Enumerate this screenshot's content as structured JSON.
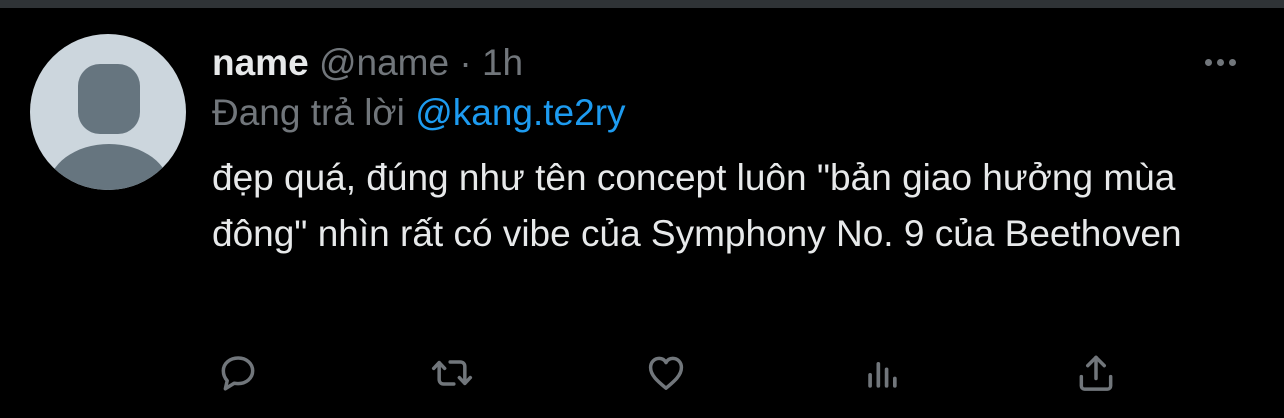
{
  "tweet": {
    "display_name": "name",
    "handle": "@name",
    "separator": "·",
    "time": "1h",
    "reply_prefix": "Đang trả lời",
    "reply_to": "@kang.te2ry",
    "text": "đẹp quá, đúng như tên concept luôn \"bản giao hưởng mùa đông\" nhìn rất có vibe của Symphony No. 9 của Beethoven"
  },
  "icons": {
    "more": "more-icon",
    "reply": "reply-icon",
    "retweet": "retweet-icon",
    "like": "heart-icon",
    "analytics": "analytics-icon",
    "share": "share-icon"
  },
  "colors": {
    "background": "#000000",
    "primary_text": "#e7e9ea",
    "secondary_text": "#71767b",
    "link": "#1d9bf0",
    "avatar_background": "#ccd6dd",
    "avatar_figure": "#66757f"
  }
}
